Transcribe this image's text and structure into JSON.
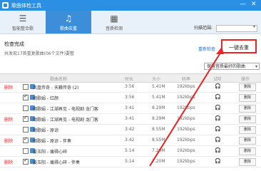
{
  "titlebar": {
    "title": "歌曲体检工具",
    "minimize": "—",
    "close": "✕"
  },
  "tabs": [
    {
      "label": "智能整合歌",
      "icon": "smart-merge-icon"
    },
    {
      "label": "歌曲去重",
      "icon": "dedupe-icon"
    },
    {
      "label": "音质检测",
      "icon": "quality-icon"
    }
  ],
  "scan": {
    "label": "扫描范围:",
    "value": ""
  },
  "status": {
    "title": "检查完成",
    "subtitle": "共发现17首重复歌曲(06个文件)要整"
  },
  "actions": {
    "rescan": "重新检查",
    "onekey": "一键去重"
  },
  "keep_select": {
    "value": "保留音质最好的歌曲"
  },
  "table": {
    "headers": {
      "name": "歌曲名称",
      "time": "时长",
      "size": "大小",
      "rate": "码率",
      "listen": "试听",
      "action": "操作"
    },
    "rows": [
      {
        "dup": "删除",
        "checked": false,
        "name": "凤凰传奇 - 天籁传奇 (2)",
        "time": "3:56",
        "size": "5.41M",
        "rate": "192kbps",
        "del": "删除"
      },
      {
        "dup": "",
        "checked": true,
        "name": "胡歌娟 - 红颜",
        "time": "3:56",
        "size": "5.41M",
        "rate": "192kbps",
        "del": "删除"
      },
      {
        "dup": "",
        "checked": false,
        "name": "胡歌娟 - 江湖再见 - 电视剧 龙门客",
        "time": "3:41",
        "size": "8.29M",
        "rate": "192kbps",
        "del": "删除"
      },
      {
        "dup": "删除",
        "checked": true,
        "name": "胡歌娟 - 江湖再见 - 电视剧 龙门客",
        "time": "3:41",
        "size": "8.29M",
        "rate": "192kbps",
        "del": "删除"
      },
      {
        "dup": "",
        "checked": false,
        "name": "胡歌娟 - 原谅",
        "time": "3:42",
        "size": "8.55M",
        "rate": "192kbps",
        "del": "删除"
      },
      {
        "dup": "删除",
        "checked": true,
        "name": "胡歌娟 - 原谅 - 伴奏",
        "time": "3:42",
        "size": "8.55M",
        "rate": "192kbps",
        "del": "删除"
      },
      {
        "dup": "",
        "checked": false,
        "name": "姜玉阳 - 痛得心碎",
        "time": "5:14",
        "size": "7.20M",
        "rate": "192kbps",
        "del": "删除"
      },
      {
        "dup": "删除",
        "checked": true,
        "name": "姜玉阳 - 痛得心碎 - 伴奏",
        "time": "5:14",
        "size": "7.20M",
        "rate": "192kbps",
        "del": "删除"
      }
    ]
  }
}
